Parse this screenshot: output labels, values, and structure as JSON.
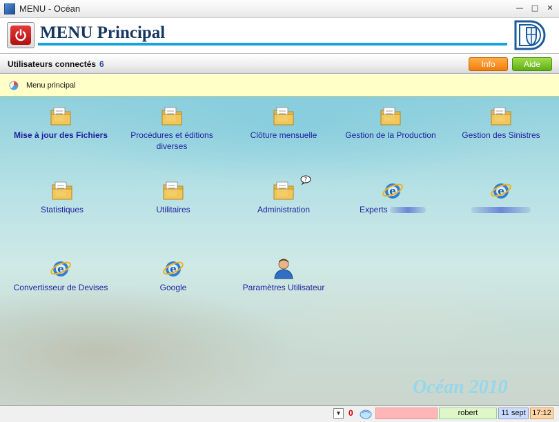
{
  "window": {
    "title": "MENU - Océan",
    "controls": [
      "minimize-icon",
      "maximize-icon",
      "close-icon"
    ]
  },
  "header": {
    "title": "MENU Principal"
  },
  "users_bar": {
    "label": "Utilisateurs connectés",
    "count": "6",
    "info_label": "Info",
    "aide_label": "Aide"
  },
  "breadcrumb": {
    "text": "Menu principal"
  },
  "menu": {
    "items": [
      {
        "label": "Mise à jour des Fichiers",
        "icon": "folder-icon"
      },
      {
        "label": "Procédures et éditions diverses",
        "icon": "folder-icon"
      },
      {
        "label": "Clôture mensuelle",
        "icon": "folder-icon"
      },
      {
        "label": "Gestion de la Production",
        "icon": "folder-icon"
      },
      {
        "label": "Gestion des Sinistres",
        "icon": "folder-icon"
      },
      {
        "label": "Statistiques",
        "icon": "folder-icon"
      },
      {
        "label": "Utilitaires",
        "icon": "folder-icon"
      },
      {
        "label": "Administration",
        "icon": "folder-icon"
      },
      {
        "label": "Experts",
        "icon": "internet-explorer-icon"
      },
      {
        "label": "",
        "icon": "internet-explorer-icon"
      },
      {
        "label": "Convertisseur de Devises",
        "icon": "internet-explorer-icon"
      },
      {
        "label": "Google",
        "icon": "internet-explorer-icon"
      },
      {
        "label": "Paramètres Utilisateur",
        "icon": "user-icon"
      }
    ]
  },
  "watermark": "Océan 2010",
  "statusbar": {
    "count": "0",
    "user": "robert",
    "date": "11 sept",
    "time": "17:12"
  },
  "colors": {
    "accent": "#1aa2db",
    "title": "#16375f",
    "link": "#1e1ea0",
    "info": "#f07d0c",
    "aide": "#5fae14"
  }
}
